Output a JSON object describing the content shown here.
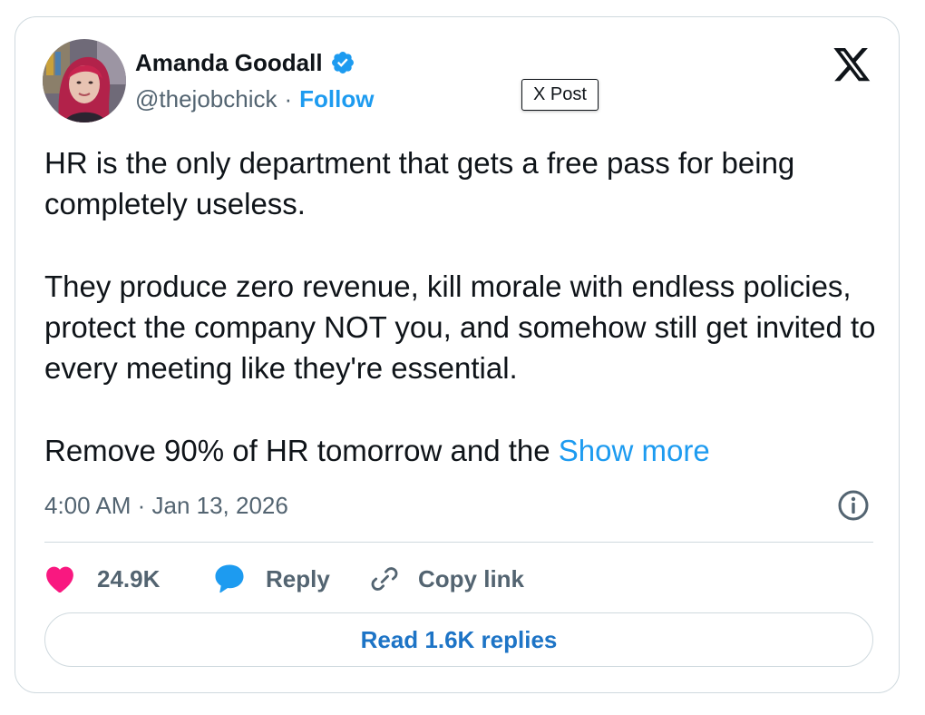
{
  "author": {
    "name": "Amanda Goodall",
    "handle": "@thejobchick",
    "separator": "·",
    "follow_label": "Follow",
    "verified": true
  },
  "tooltip": {
    "text": "X Post"
  },
  "tweet": {
    "paragraphs": [
      "HR is the only department that gets a free pass for being completely useless.",
      "They produce zero revenue, kill morale with endless policies, protect the company NOT you, and somehow still get invited to every meeting like they're essential.",
      "Remove 90% of HR tomorrow and the"
    ],
    "show_more_label": "Show more",
    "timestamp": "4:00 AM · Jan 13, 2026"
  },
  "actions": {
    "like_count": "24.9K",
    "reply_label": "Reply",
    "copy_link_label": "Copy link"
  },
  "replies_button": {
    "label": "Read 1.6K replies"
  },
  "icons": {
    "avatar": "avatar-photo",
    "verified": "verified-badge-icon",
    "logo": "x-logo-icon",
    "info": "info-icon",
    "like": "heart-icon",
    "reply": "speech-bubble-icon",
    "copy": "link-icon"
  },
  "colors": {
    "accent": "#1d9bf0",
    "like": "#f91880",
    "text": "#0f1419",
    "secondary_text": "#536471",
    "border": "#cfd9de"
  }
}
